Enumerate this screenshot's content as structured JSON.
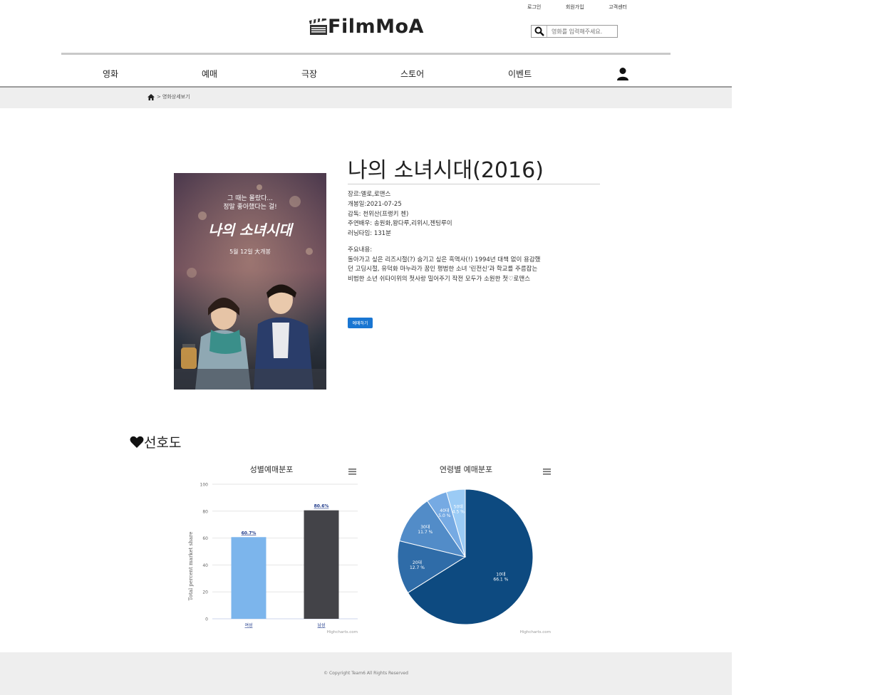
{
  "header": {
    "top_links": [
      "로그인",
      "회원가입",
      "고객센터"
    ],
    "logo_text": "FilmMoA",
    "search_placeholder": "영화를 입력해주세요."
  },
  "nav": {
    "items": [
      "영화",
      "예매",
      "극장",
      "스토어",
      "이벤트"
    ]
  },
  "breadcrumb": {
    "sep": ">",
    "current": "영화상세보기"
  },
  "movie": {
    "title": "나의 소녀시대(2016)",
    "details": [
      "장르:멜로,로맨스",
      "개봉일:2021-07-25",
      "감독: 천위산(프랭키 첸)",
      "주연배우: 송원화,왕다루,리위시,젠팅루이",
      "러닝타임: 131분"
    ],
    "synopsis_label": "주요내용:",
    "synopsis": [
      "돌아가고 싶은 리즈시절(?) 숨기고 싶은 흑역사(!) 1994년 대책 없이 용감했",
      "던 고딩시절, 유덕화 마누라가 꿈인 평범한 소녀 '린전신'과 학교를 주름잡는",
      "비범한 소년 쉬타이위의 첫사랑 밀어주기 작전 모두가 소원한 첫♡로맨스"
    ],
    "book_label": "예매하기",
    "poster": {
      "tagline_1": "그 때는 몰랐다...",
      "tagline_2": "정말 좋아했다는 걸!",
      "title": "나의 소녀시대",
      "release": "5월 12일 大개봉"
    }
  },
  "preference_title": "선호도",
  "chart_data": [
    {
      "type": "bar",
      "title": "성별예매분포",
      "categories": [
        "여성",
        "남성"
      ],
      "values": [
        60.7,
        80.6
      ],
      "data_labels": [
        "60.7%",
        "80.6%"
      ],
      "ylabel": "Total percent market share",
      "ylim": [
        0,
        100
      ],
      "y_ticks": [
        0,
        20,
        40,
        60,
        80,
        100
      ],
      "colors": [
        "#7cb5ec",
        "#434348"
      ],
      "credits": "Highcharts.com",
      "grid": true
    },
    {
      "type": "pie",
      "title": "연령별 예매분포",
      "slices": [
        {
          "label": "10대",
          "value": 66.1,
          "text": "66.1 %",
          "color": "#0d4a80"
        },
        {
          "label": "20대",
          "value": 12.7,
          "text": "12.7 %",
          "color": "#2f6ca8"
        },
        {
          "label": "30대",
          "value": 11.7,
          "text": "11.7 %",
          "color": "#528cc8"
        },
        {
          "label": "40대",
          "value": 5.0,
          "text": "5.0 %",
          "color": "#76aae3"
        },
        {
          "label": "50대",
          "value": 4.5,
          "text": "4.5 %",
          "color": "#9bcbf5"
        }
      ],
      "credits": "Highcharts.com"
    }
  ],
  "footer": {
    "copyright": "© Copyright Team6 All Rights Reserved"
  }
}
